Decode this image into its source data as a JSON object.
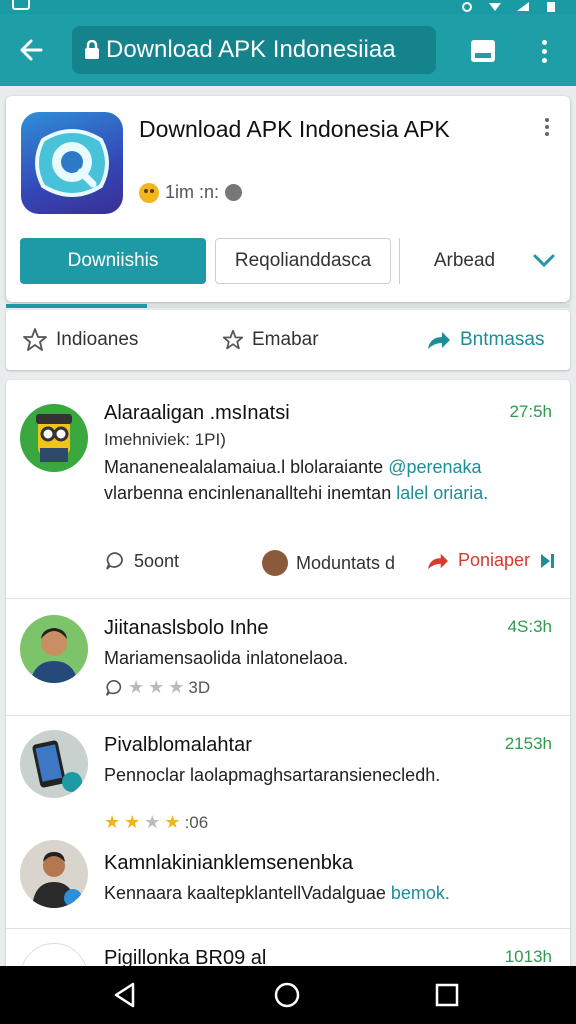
{
  "colors": {
    "accent": "#1e9ea7",
    "time": "#2e9a4c",
    "reply": "#d63a2a"
  },
  "toolbar": {
    "url_text": "Download APK Indonesiiaa",
    "icons": [
      "back-arrow-icon",
      "lock-icon",
      "bookmark-icon",
      "more-vert-icon"
    ]
  },
  "app": {
    "title": "Download APK Indonesia APK",
    "meta": "1im :n:",
    "buttons": {
      "primary": "Downiishis",
      "secondary": "Reqolianddasca",
      "tertiary": "Arbead"
    },
    "progress_fraction": 0.25
  },
  "actions": {
    "follow": "Indioanes",
    "rate": "Emabar",
    "share": "Bntmasas"
  },
  "posts": [
    {
      "name": "Alaraaligan .msInatsi",
      "time": "27:5h",
      "subtitle": "Imehniviek: 1PI)",
      "text": "Mananenealalamaiua.l blolaraiante ",
      "text_link": "@perenaka",
      "text_cont": " vlarbenna encinlenanalltehi inemtan ",
      "text_link2": "lalel oriaria.",
      "likes": "5oont",
      "author_stat": "Moduntats d",
      "reply": "Poniaper"
    },
    {
      "name": "Jiitanaslsbolo Inhe",
      "time": "4S:3h",
      "text": "Mariamensaolida inlatonelaoa.",
      "rating_text": "3D"
    },
    {
      "name": "Pivalblomalahtar",
      "time": "2153h",
      "text": "Pennoclar laolapmaghsartaransienecledh.",
      "rating_text": ":06"
    },
    {
      "name": "Kamnlakinianklemsenenbka",
      "text": "Kennaara kaaltepklantellVadalguae ",
      "text_link": "bemok."
    },
    {
      "name": "Pigillonka BR09 al",
      "time": "1013h"
    }
  ]
}
